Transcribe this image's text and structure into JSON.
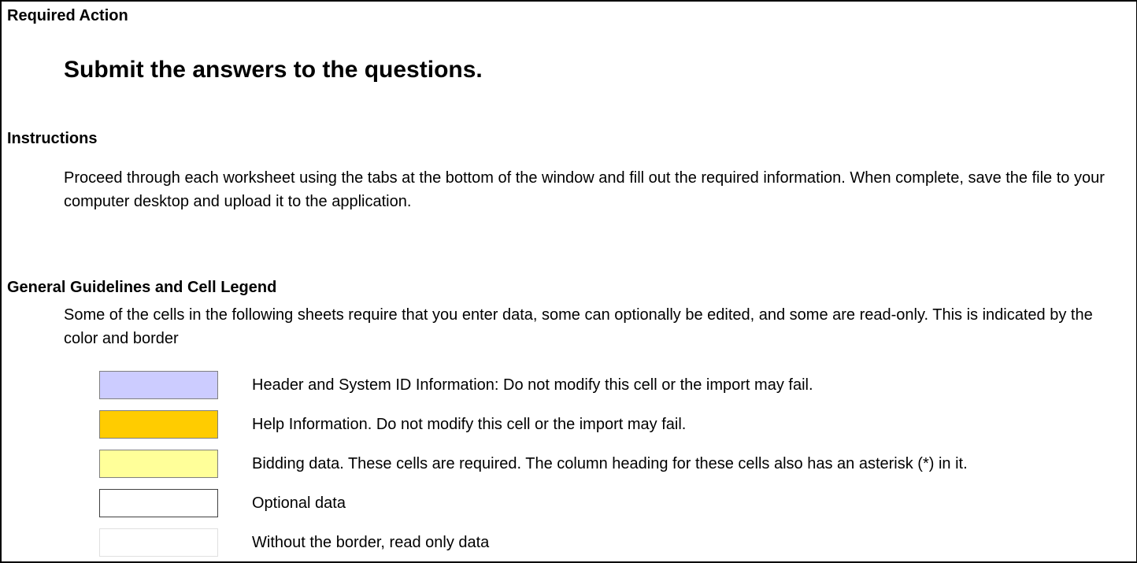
{
  "required_action": {
    "label": "Required Action",
    "text": "Submit the answers to the questions."
  },
  "instructions": {
    "label": "Instructions",
    "text": "Proceed through each worksheet using the tabs at the bottom of the window and fill out the required information. When complete, save the file to your computer desktop and upload it to the application."
  },
  "guidelines": {
    "label": "General Guidelines and Cell Legend",
    "text": "Some of the cells in the following sheets require that you enter data, some can optionally be edited, and some are read-only.  This is indicated by the color and border"
  },
  "legend": [
    {
      "text": "Header and System ID Information: Do not modify this cell or the import may fail.",
      "fill": "#ccccff",
      "border": "#7f7f7f"
    },
    {
      "text": "Help Information. Do not modify this cell or the import may fail.",
      "fill": "#ffcc00",
      "border": "#7f7f7f"
    },
    {
      "text": "Bidding data. These cells are required. The column heading for these cells also has an asterisk (*) in it.",
      "fill": "#ffff99",
      "border": "#7f7f7f"
    },
    {
      "text": "Optional data",
      "fill": "#ffffff",
      "border": "#404040"
    },
    {
      "text": "Without the border, read only data",
      "fill": "#ffffff",
      "border": "#e0e0e0"
    }
  ]
}
